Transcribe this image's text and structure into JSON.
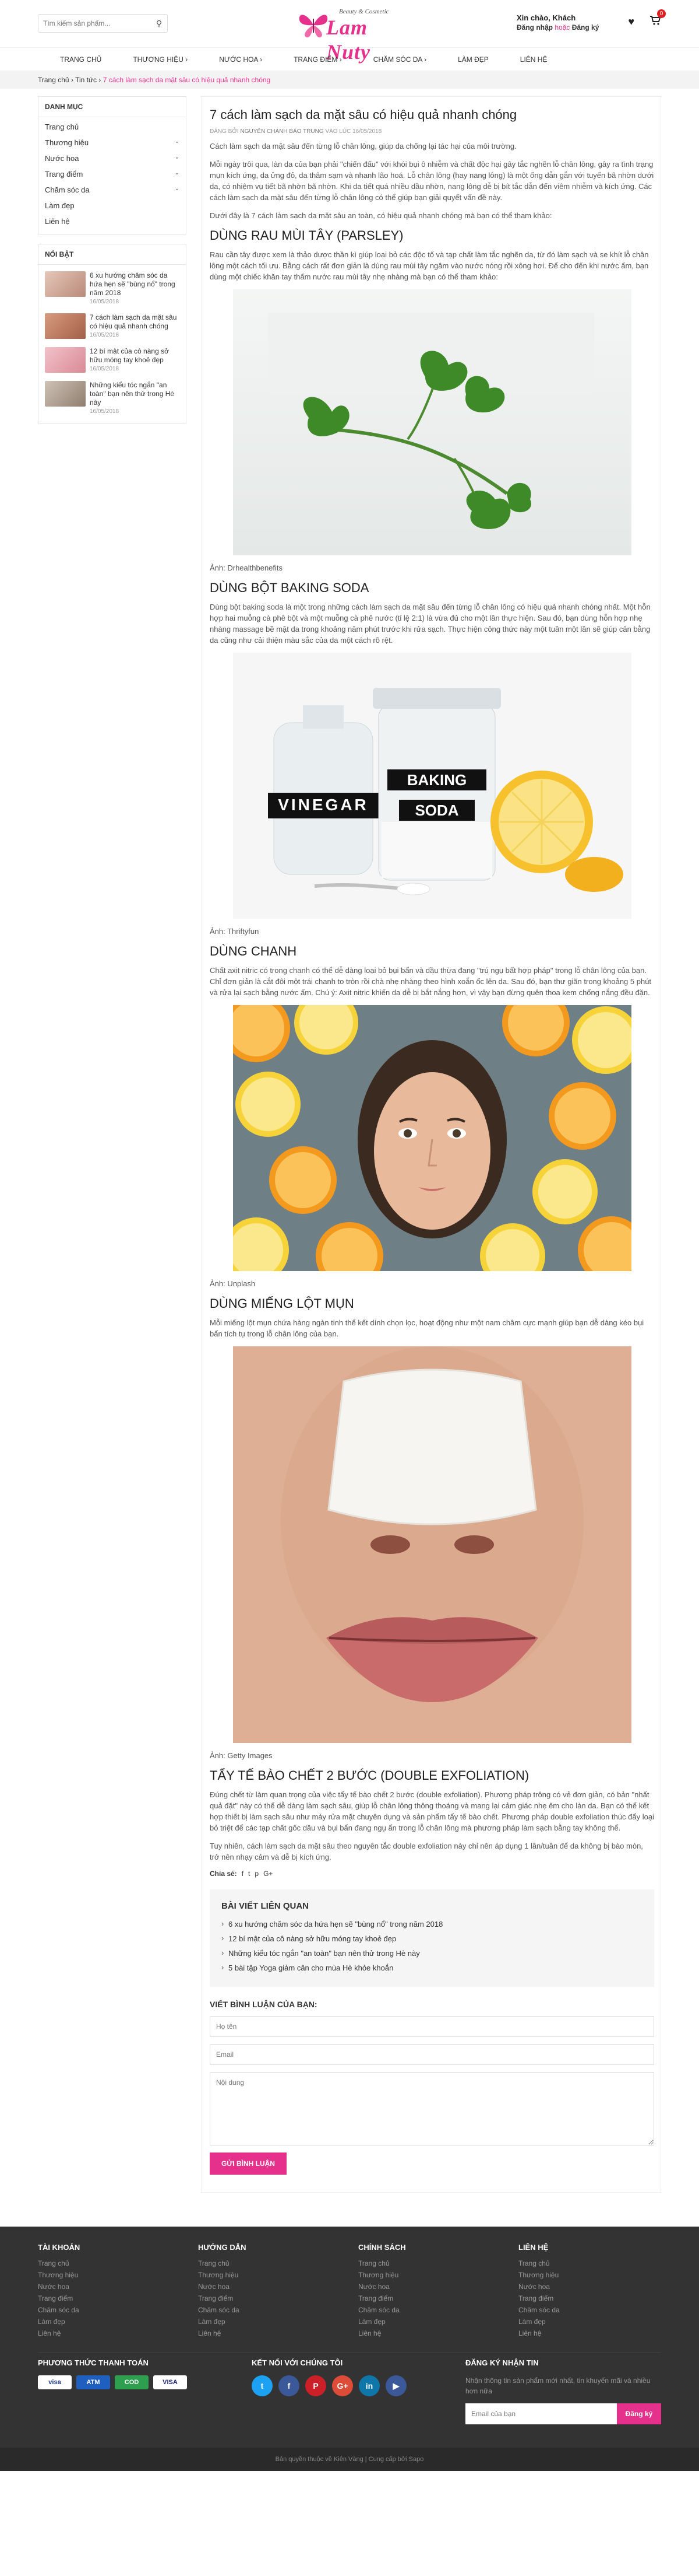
{
  "header": {
    "search_placeholder": "Tìm kiếm sản phẩm...",
    "logo_tag": "Beauty & Cosmetic",
    "logo_name": "Lam Nuty",
    "greeting": "Xin chào, Khách",
    "login": "Đăng nhập",
    "or": "hoặc",
    "register": "Đăng ký",
    "cart_count": "0"
  },
  "nav": [
    "TRANG CHỦ",
    "THƯƠNG HIỆU ›",
    "NƯỚC HOA ›",
    "TRANG ĐIỂM ›",
    "CHĂM SÓC DA ›",
    "LÀM ĐẸP",
    "LIÊN HỆ"
  ],
  "breadcrumb": {
    "home": "Trang chủ",
    "sep": "›",
    "news": "Tin tức",
    "current": "7 cách làm sạch da mặt sâu có hiệu quả nhanh chóng"
  },
  "sidebar": {
    "categories_title": "DANH MỤC",
    "categories": [
      {
        "label": "Trang chủ",
        "chevron": ""
      },
      {
        "label": "Thương hiệu",
        "chevron": "⌄"
      },
      {
        "label": "Nước hoa",
        "chevron": "⌄"
      },
      {
        "label": "Trang điểm",
        "chevron": "⌄"
      },
      {
        "label": "Chăm sóc da",
        "chevron": "⌄"
      },
      {
        "label": "Làm đẹp",
        "chevron": ""
      },
      {
        "label": "Liên hệ",
        "chevron": ""
      }
    ],
    "featured_title": "NỔI BẬT",
    "featured": [
      {
        "title": "6 xu hướng chăm sóc da hứa hẹn sẽ \"bùng nổ\" trong năm 2018",
        "date": "16/05/2018",
        "color": "#cfa99a"
      },
      {
        "title": "7 cách làm sạch da mặt sâu có hiệu quả nhanh chóng",
        "date": "16/05/2018",
        "color": "#c8826a"
      },
      {
        "title": "12 bí mật của cô nàng sở hữu móng tay khoẻ đẹp",
        "date": "16/05/2018",
        "color": "#e2a6ae"
      },
      {
        "title": "Những kiểu tóc ngắn \"an toàn\" bạn nên thử trong Hè này",
        "date": "16/05/2018",
        "color": "#b9a89a"
      }
    ]
  },
  "article": {
    "title": "7 cách làm sạch da mặt sâu có hiệu quả nhanh chóng",
    "meta_prefix": "ĐĂNG BỞI",
    "meta_author": "NGUYỄN CHÁNH BẢO TRUNG",
    "meta_suffix": "VÀO LÚC 16/05/2018",
    "intro1": "Cách làm sạch da mặt sâu đến từng lỗ chân lông, giúp da chống lại tác hại của môi trường.",
    "intro2": "Mỗi ngày trôi qua, làn da của bạn phải \"chiến đấu\" với khói bụi ô nhiễm và chất độc hại gây tắc nghẽn lỗ chân lông, gây ra tình trạng mụn kích ứng, da ửng đỏ, da thâm sạm và nhanh lão hoá. Lỗ chân lông (hay nang lông) là một ống dẫn gắn với tuyến bã nhờn dưới da, có nhiệm vụ tiết bã nhờn bã nhờn. Khi da tiết quá nhiều dầu nhờn, nang lông dễ bị bít tắc dẫn đến viêm nhiễm và kích ứng. Các cách làm sạch da mặt sâu đến từng lỗ chân lông có thể giúp bạn giải quyết vấn đề này.",
    "intro3": "Dưới đây là 7 cách làm sạch da mặt sâu an toàn, có hiệu quả nhanh chóng mà bạn có thể tham khảo:",
    "s1_title": "DÙNG RAU MÙI TÂY (PARSLEY)",
    "s1_text": "Rau cần tây được xem là thảo dược thần kì giúp loại bỏ các độc tố và tạp chất làm tắc nghẽn da, từ đó làm sạch và se khít lỗ chân lông một cách tối ưu. Bằng cách rất đơn giản là dùng rau mùi tây ngâm vào nước nóng rồi xông hơi. Để cho đến khi nước ấm, bạn dùng một chiếc khăn tay thấm nước rau mùi tây nhẹ nhàng mà bạn có thể tham khảo:",
    "s1_caption": "Ảnh: Drhealthbenefits",
    "s2_title": "DÙNG BỘT BAKING SODA",
    "s2_text": "Dùng bột baking soda là một trong những cách làm sạch da mặt sâu đến từng lỗ chân lông có hiệu quả nhanh chóng nhất. Một hỗn hợp hai muỗng cà phê bột và một muỗng cà phê nước (tỉ lệ 2:1) là vừa đủ cho một lần thực hiện. Sau đó, bạn dùng hỗn hợp nhẹ nhàng massage bề mặt da trong khoảng năm phút trước khi rửa sạch. Thực hiện công thức này một tuần một lần sẽ giúp cân bằng da cũng như cải thiện màu sắc của da một cách rõ rệt.",
    "s2_caption": "Ảnh: Thriftyfun",
    "s3_title": "DÙNG CHANH",
    "s3_text": "Chất axit nitric có trong chanh có thể dễ dàng loại bỏ bụi bẩn và dầu thừa đang \"trú ngụ bất hợp pháp\" trong lỗ chân lông của bạn. Chỉ đơn giản là cắt đôi một trái chanh to tròn rồi chà nhẹ nhàng theo hình xoắn ốc lên da. Sau đó, bạn thư giãn trong khoảng 5 phút và rửa lại sạch bằng nước ấm. Chú ý: Axit nitric khiến da dễ bị bắt nắng hơn, vì vậy bạn đừng quên thoa kem chống nắng đều đặn.",
    "s3_caption": "Ảnh: Unplash",
    "s4_title": "DÙNG MIẾNG LỘT MỤN",
    "s4_text": "Mỗi miếng lột mụn chứa hàng ngàn tinh thể kết dính chọn lọc, hoạt động như một nam châm cực mạnh giúp bạn dễ dàng kéo bụi bẩn tích tụ trong lỗ chân lông của bạn.",
    "s4_caption": "Ảnh: Getty Images",
    "s5_title": "TẨY TẾ BÀO CHẾT 2 BƯỚC (DOUBLE EXFOLIATION)",
    "s5_text": "Đúng chết từ làm quan trọng của việc tẩy tế bào chết 2 bước (double exfoliation). Phương pháp trông có vẻ đơn giản, có bản \"nhất quả đặt\" này có thể dễ dàng làm sạch sâu, giúp lỗ chân lông thông thoáng và mang lại cảm giác nhẹ êm cho làn da. Bạn có thể kết hợp thiết bị làm sạch sâu như máy rửa mặt chuyên dụng và sản phẩm tẩy tế bào chết. Phương pháp double exfoliation thúc đẩy loại bỏ triệt để các tạp chất gốc dầu và bụi bẩn đang ngụ ẩn trong lỗ chân lông mà phương pháp làm sạch bằng tay không thể.",
    "s5_text2": "Tuy nhiên, cách làm sạch da mặt sâu theo nguyên tắc double exfoliation này chỉ nên áp dụng 1 lần/tuần để da không bị bào mòn, trở nên nhạy cảm và dễ bị kích ứng.",
    "share_label": "Chia sẻ:",
    "share_icons": [
      "f",
      "t",
      "p",
      "G+"
    ]
  },
  "related": {
    "title": "BÀI VIẾT LIÊN QUAN",
    "items": [
      "6 xu hướng chăm sóc da hứa hẹn sẽ \"bùng nổ\" trong năm 2018",
      "12 bí mật của cô nàng sở hữu móng tay khoẻ đẹp",
      "Những kiểu tóc ngắn \"an toàn\" bạn nên thử trong Hè này",
      "5 bài tập Yoga giảm cân cho mùa Hè khỏe khoắn"
    ]
  },
  "comment": {
    "title": "VIẾT BÌNH LUẬN CỦA BẠN:",
    "name_ph": "Họ tên",
    "email_ph": "Email",
    "content_ph": "Nội dung",
    "submit": "GỬI BÌNH LUẬN"
  },
  "footer": {
    "cols": [
      {
        "title": "TÀI KHOẢN",
        "items": [
          "Trang chủ",
          "Thương hiệu",
          "Nước hoa",
          "Trang điểm",
          "Chăm sóc da",
          "Làm đẹp",
          "Liên hệ"
        ]
      },
      {
        "title": "HƯỚNG DẪN",
        "items": [
          "Trang chủ",
          "Thương hiệu",
          "Nước hoa",
          "Trang điểm",
          "Chăm sóc da",
          "Làm đẹp",
          "Liên hệ"
        ]
      },
      {
        "title": "CHÍNH SÁCH",
        "items": [
          "Trang chủ",
          "Thương hiệu",
          "Nước hoa",
          "Trang điểm",
          "Chăm sóc da",
          "Làm đẹp",
          "Liên hệ"
        ]
      },
      {
        "title": "LIÊN HỆ",
        "items": [
          "Trang chủ",
          "Thương hiệu",
          "Nước hoa",
          "Trang điểm",
          "Chăm sóc da",
          "Làm đẹp",
          "Liên hệ"
        ]
      }
    ],
    "payment_title": "PHƯƠNG THỨC THANH TOÁN",
    "payments": [
      {
        "label": "visa",
        "bg": "#ffffff",
        "fg": "#1a3a8f"
      },
      {
        "label": "ATM",
        "bg": "#1f5fbf",
        "fg": "#ffffff"
      },
      {
        "label": "COD",
        "bg": "#2e9e4f",
        "fg": "#ffffff"
      },
      {
        "label": "VISA",
        "bg": "#ffffff",
        "fg": "#1a1f71"
      }
    ],
    "social_title": "KẾT NỐI VỚI CHÚNG TÔI",
    "socials": [
      {
        "label": "t",
        "bg": "#1da1f2"
      },
      {
        "label": "f",
        "bg": "#3b5998"
      },
      {
        "label": "P",
        "bg": "#cb2027"
      },
      {
        "label": "G+",
        "bg": "#dd4b39"
      },
      {
        "label": "in",
        "bg": "#0e76a8"
      },
      {
        "label": "▶",
        "bg": "#3b5998"
      }
    ],
    "newsletter_title": "ĐĂNG KÝ NHẬN TIN",
    "newsletter_text": "Nhận thông tin sản phẩm mới nhất, tin khuyến mãi và nhiều hơn nữa",
    "newsletter_ph": "Email của bạn",
    "newsletter_btn": "Đăng ký",
    "copyright": "Bản quyền thuộc về Kiên Vàng | Cung cấp bởi Sapo"
  }
}
